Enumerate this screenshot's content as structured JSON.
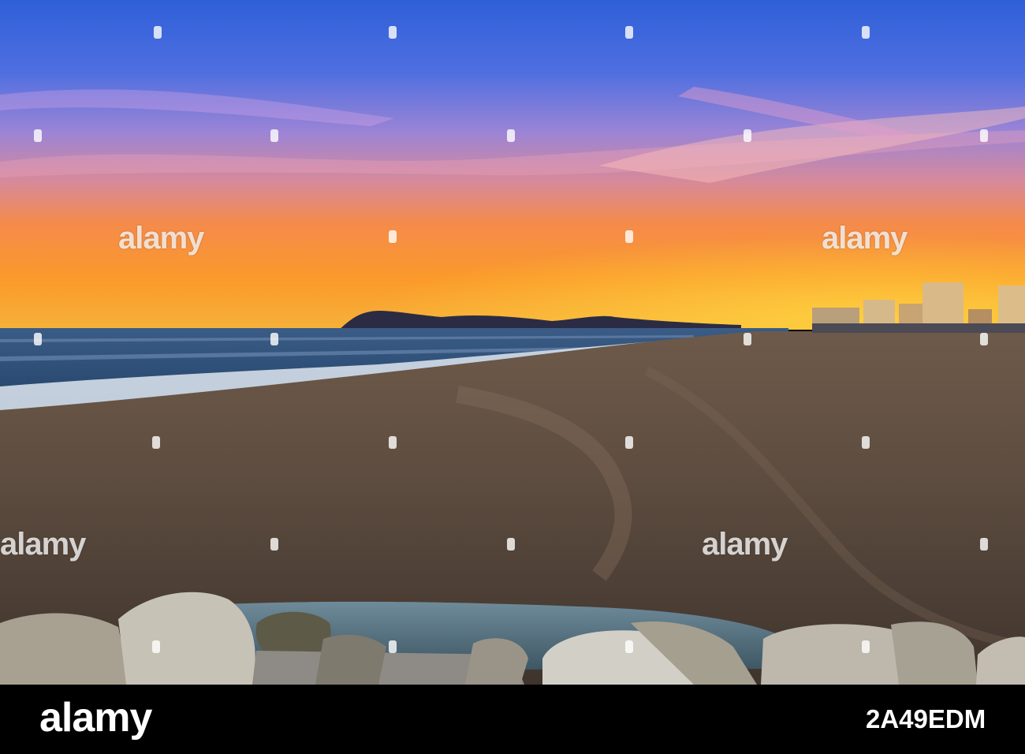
{
  "watermark": {
    "text": "alamy"
  },
  "footer": {
    "logo": "alamy",
    "image_id": "2A49EDM"
  },
  "colors": {
    "sky_top": "#2f62d9",
    "sky_mid": "#b47fd0",
    "sky_horizon": "#f79a2c",
    "sea": "#2b4f78",
    "sand": "#5b4a3e",
    "footer_bg": "#000000"
  }
}
